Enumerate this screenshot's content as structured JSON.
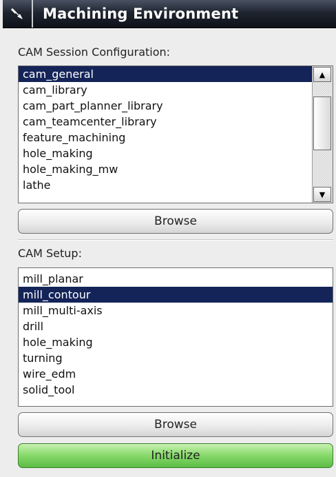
{
  "panel": {
    "title": "Machining Environment",
    "pin_icon": "pin-icon"
  },
  "session": {
    "label": "CAM Session Configuration:",
    "items": [
      "cam_general",
      "cam_library",
      "cam_part_planner_library",
      "cam_teamcenter_library",
      "feature_machining",
      "hole_making",
      "hole_making_mw",
      "lathe"
    ],
    "selected": "cam_general",
    "browse_label": "Browse"
  },
  "setup": {
    "label": "CAM Setup:",
    "items": [
      "mill_planar",
      "mill_contour",
      "mill_multi-axis",
      "drill",
      "hole_making",
      "turning",
      "wire_edm",
      "solid_tool"
    ],
    "selected": "mill_contour",
    "browse_label": "Browse"
  },
  "initialize_label": "Initialize",
  "colors": {
    "selection": "#142459",
    "title_bar": "#1f2530",
    "initialize": "#86d86a"
  }
}
